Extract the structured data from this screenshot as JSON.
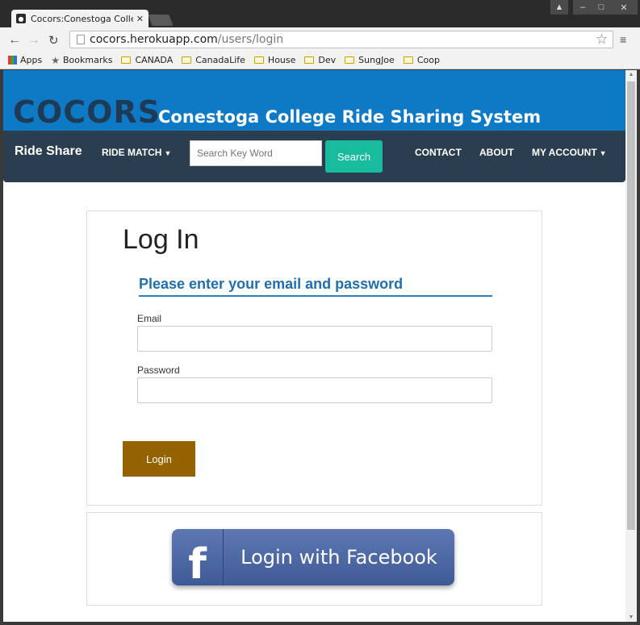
{
  "browser": {
    "tab_title": "Cocors:Conestoga Colleg",
    "url_host": "cocors.herokuapp.com",
    "url_path": "/users/login",
    "bookmarks": [
      "Apps",
      "Bookmarks",
      "CANADA",
      "CanadaLife",
      "House",
      "Dev",
      "SungJoe",
      "Coop"
    ]
  },
  "site": {
    "logo": "COCORS",
    "tagline": "Conestoga College Ride Sharing System",
    "brand_color": "#0e7ac6"
  },
  "navbar": {
    "brand": "Ride Share",
    "ride_match": "RIDE MATCH",
    "search_placeholder": "Search Key Word",
    "search_button": "Search",
    "contact": "CONTACT",
    "about": "ABOUT",
    "my_account": "MY ACCOUNT"
  },
  "login": {
    "title": "Log In",
    "subtitle": "Please enter your email and password",
    "email_label": "Email",
    "email_value": "",
    "password_label": "Password",
    "password_value": "",
    "submit": "Login",
    "facebook": "Login with Facebook",
    "facebook_icon": "f"
  }
}
